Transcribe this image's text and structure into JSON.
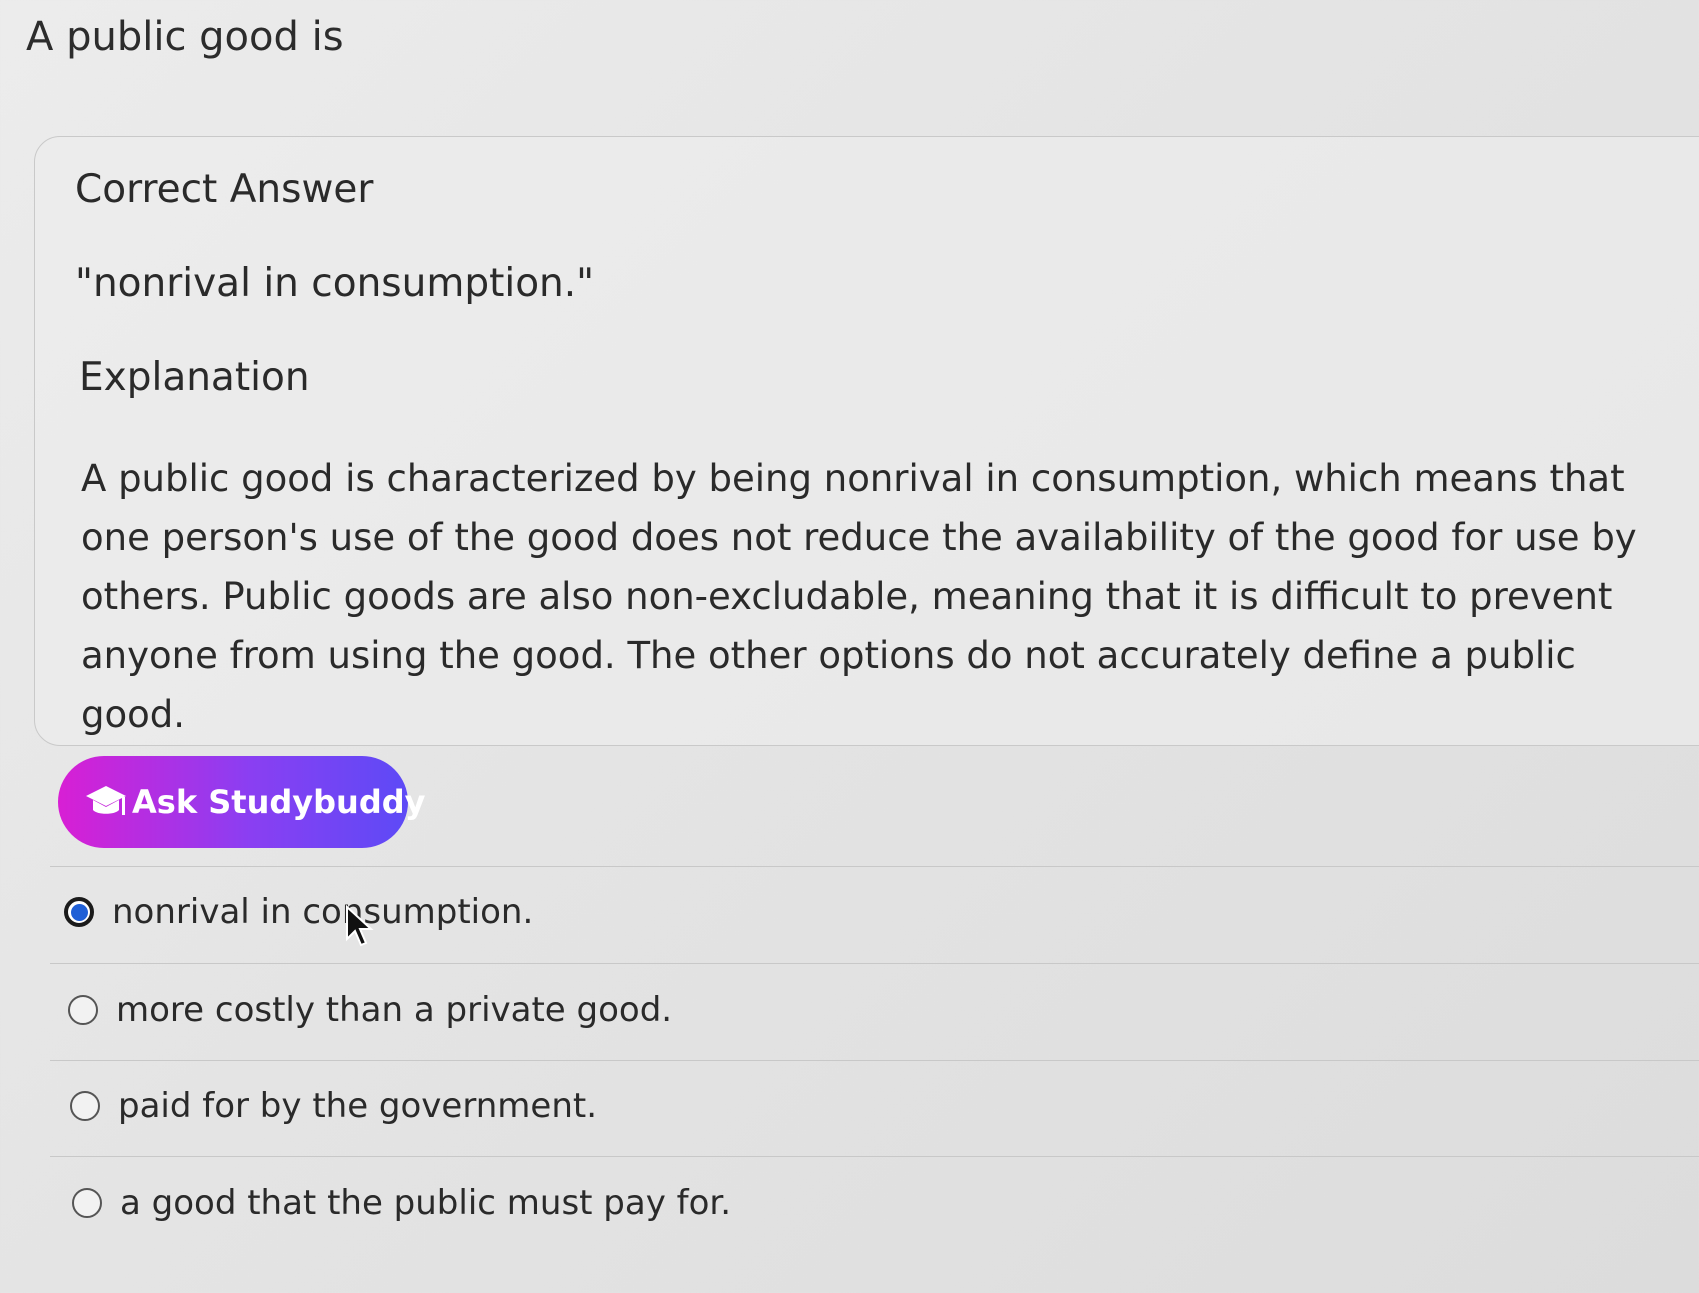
{
  "question": {
    "title": "A public good is"
  },
  "answer_card": {
    "correct_heading": "Correct Answer",
    "correct_value": "\"nonrival in consumption.\"",
    "explanation_heading": "Explanation",
    "explanation_body": "A public good is characterized by being nonrival in consumption, which means that one person's use of the good does not reduce the availability of the good for use by others. Public goods are also non-excludable, meaning that it is difficult to prevent anyone from using the good. The other options do not accurately define a public good."
  },
  "ask_button": {
    "label": "Ask Studybuddy",
    "icon": "graduation-cap-icon",
    "gradient": [
      "#d81fd4",
      "#8a3ff2",
      "#5d4af6"
    ]
  },
  "options": [
    {
      "label": "nonrival in consumption.",
      "selected": true
    },
    {
      "label": "more costly than a private good.",
      "selected": false
    },
    {
      "label": "paid for by the government.",
      "selected": false
    },
    {
      "label": "a good that the public must pay for.",
      "selected": false
    }
  ],
  "colors": {
    "selected_radio": "#1f5fd6",
    "text": "#2a2a2a"
  }
}
